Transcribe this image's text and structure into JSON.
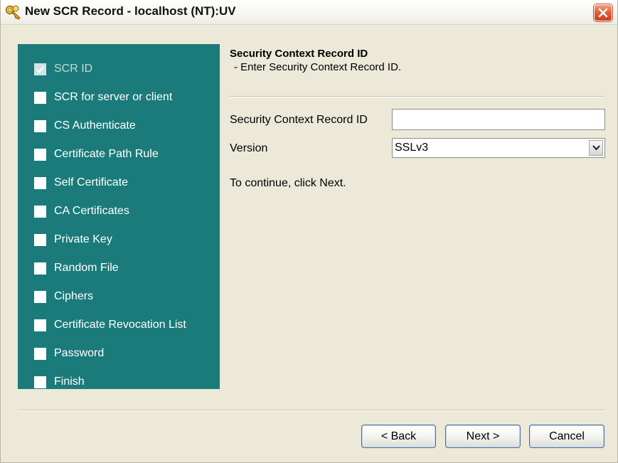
{
  "window": {
    "title": "New SCR Record - localhost (NT):UV",
    "icon": "key-icon",
    "close_icon": "close-icon"
  },
  "steps": [
    {
      "label": "SCR ID",
      "completed": true
    },
    {
      "label": "SCR for server or client",
      "completed": false
    },
    {
      "label": "CS Authenticate",
      "completed": false
    },
    {
      "label": "Certificate Path Rule",
      "completed": false
    },
    {
      "label": "Self Certificate",
      "completed": false
    },
    {
      "label": "CA Certificates",
      "completed": false
    },
    {
      "label": "Private Key",
      "completed": false
    },
    {
      "label": "Random File",
      "completed": false
    },
    {
      "label": "Ciphers",
      "completed": false
    },
    {
      "label": "Certificate Revocation List",
      "completed": false
    },
    {
      "label": "Password",
      "completed": false
    },
    {
      "label": "Finish",
      "completed": false
    }
  ],
  "panel": {
    "title": "Security Context Record ID",
    "subtitle": "- Enter Security Context Record ID.",
    "scr_id_label": "Security Context Record ID",
    "scr_id_value": "",
    "version_label": "Version",
    "version_value": "SSLv3",
    "continue_text": "To continue, click Next."
  },
  "buttons": {
    "back": "< Back",
    "next": "Next >",
    "cancel": "Cancel"
  },
  "colors": {
    "sidebar_bg": "#1a7b7a",
    "window_bg": "#ece9d8",
    "close_button": "#d9542e"
  }
}
